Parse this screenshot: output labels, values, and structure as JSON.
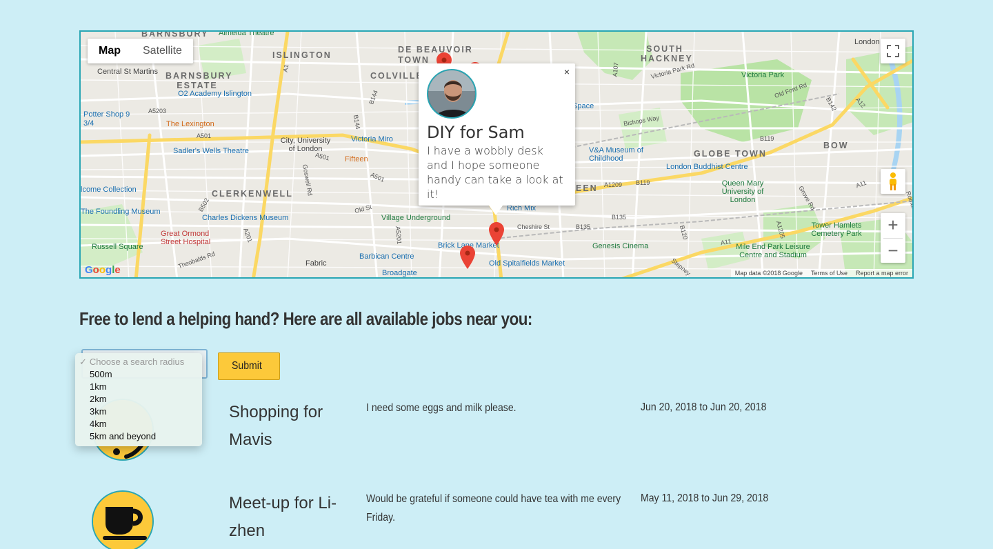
{
  "map": {
    "type_buttons": [
      "Map",
      "Satellite"
    ],
    "districts": [
      "BARNSBURY",
      "ISLINGTON",
      "DE BEAUVOIR TOWN",
      "SOUTH HACKNEY",
      "BARNSBURY ESTATE",
      "COLVILLE",
      "CLERKENWELL",
      "GLOBE TOWN",
      "BOW",
      "EEN"
    ],
    "pois": [
      "Almeida Theatre",
      "Central St Martins",
      "O2 Academy Islington",
      "Potter Shop 9 3/4",
      "The Lexington",
      "Sadler's Wells Theatre",
      "City, University of London",
      "Victoria Miro",
      "Fifteen",
      "lcome Collection",
      "The Foundling Museum",
      "Charles Dickens Museum",
      "Great Ormond Street Hospital",
      "Russell Square",
      "Village Underground",
      "Barbican Centre",
      "Fabric",
      "Broadgate",
      "Brick Lane Market",
      "Old Spitalfields Market",
      "Rich Mix",
      "V&A Museum of Childhood",
      "London Buddhist Centre",
      "Queen Mary University of London",
      "Genesis Cinema",
      "Mile End Park Leisure Centre and Stadium",
      "Tower Hamlets Cemetery Park",
      "Victoria Park",
      "London Sta",
      "Space"
    ],
    "roads": [
      "A1",
      "A5203",
      "A501",
      "A501",
      "A501",
      "B144",
      "B144",
      "A107",
      "B119",
      "B119",
      "A1209",
      "B135",
      "A11",
      "A11",
      "A12",
      "Old Ford Rd",
      "Bishops Way",
      "Cheshire St",
      "Old St",
      "B135",
      "A1205",
      "B120",
      "Victoria Park Rd",
      "Grove Rd",
      "Theobalds Rd",
      "Goswell Rd",
      "A201",
      "B502",
      "A5201",
      "B142",
      "Stepney",
      "Roman"
    ],
    "footer": [
      "Map data ©2018 Google",
      "Terms of Use",
      "Report a map error"
    ],
    "google": "Google",
    "info_window": {
      "title": "DIY for Sam",
      "body": "I have a wobbly desk and I hope someone handy can take a look at it!",
      "close": "×"
    },
    "controls": {
      "zoom_in": "+",
      "zoom_out": "−"
    }
  },
  "heading": "Free to lend a helping hand? Here are all available jobs near you:",
  "radius": {
    "placeholder": "Choose a search radius",
    "options": [
      "500m",
      "1km",
      "2km",
      "3km",
      "4km",
      "5km and beyond"
    ]
  },
  "submit_label": "Submit",
  "jobs": [
    {
      "title": "Shopping for Mavis",
      "description": "I need some eggs and milk please.",
      "dates": "Jun 20, 2018 to Jun 20, 2018",
      "icon": "smiley-icon"
    },
    {
      "title": "Meet-up for Li-zhen",
      "description": "Would be grateful if someone could have tea with me every Friday.",
      "dates": "May 11, 2018 to Jun 29, 2018",
      "icon": "coffee-cup-icon"
    }
  ],
  "colors": {
    "background": "#cdeef6",
    "accent": "#fcc93a",
    "border": "#2aa6b4"
  }
}
